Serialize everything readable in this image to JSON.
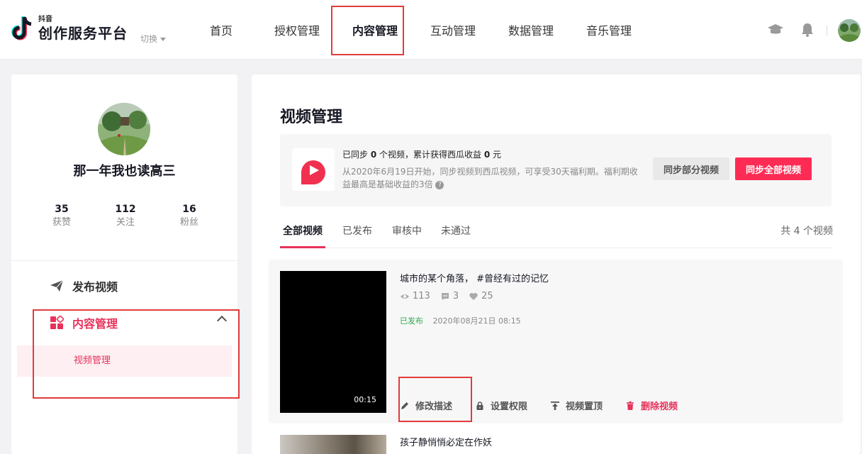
{
  "header": {
    "logo_small": "抖音",
    "logo_big": "创作服务平台",
    "switch_label": "切换",
    "nav": [
      "首页",
      "授权管理",
      "内容管理",
      "互动管理",
      "数据管理",
      "音乐管理"
    ],
    "active_nav": "内容管理",
    "icons": [
      "graduation-cap-icon",
      "bell-icon",
      "avatar"
    ]
  },
  "sidebar": {
    "name": "那一年我也读高三",
    "stats": [
      {
        "num": "35",
        "label": "获赞"
      },
      {
        "num": "112",
        "label": "关注"
      },
      {
        "num": "16",
        "label": "粉丝"
      }
    ],
    "menu": {
      "publish": "发布视频",
      "content": "内容管理",
      "sub_video": "视频管理"
    }
  },
  "main": {
    "title": "视频管理",
    "banner": {
      "line1_prefix": "已同步 ",
      "line1_count": "0",
      "line1_mid": " 个视频，累计获得西瓜收益 ",
      "line1_income": "0",
      "line1_suffix": " 元",
      "line2": "从2020年6月19日开始，同步视频到西瓜视频，可享受30天福利期。福利期收益最高是基础收益的3倍",
      "btn_partial": "同步部分视频",
      "btn_all": "同步全部视频"
    },
    "tabs": [
      "全部视频",
      "已发布",
      "审核中",
      "未通过"
    ],
    "count_text": "共 4 个视频",
    "videos": [
      {
        "title": "城市的某个角落， #曾经有过的记忆",
        "views": "113",
        "comments": "3",
        "likes": "25",
        "status": "已发布",
        "datetime": "2020年08月21日 08:15",
        "duration": "00:15"
      },
      {
        "title": "孩子静悄悄必定在作妖"
      }
    ],
    "actions": [
      "修改描述",
      "设置权限",
      "视频置顶",
      "删除视频"
    ]
  },
  "colors": {
    "accent": "#fe2c55",
    "menu_active": "#e8325b",
    "status_published": "#2eaa4a",
    "highlight_box": "#e33b3b"
  }
}
